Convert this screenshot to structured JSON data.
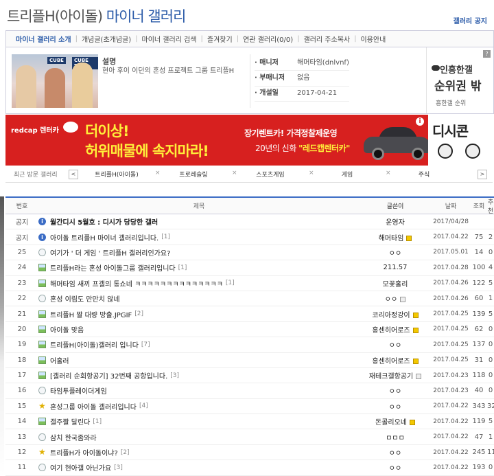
{
  "header": {
    "title_main": "트리플H(아이돌)",
    "title_sub": "마이너 갤러리",
    "gallery_notice": "갤러리 공지"
  },
  "tabs": [
    "마이너 갤러리 소개",
    "개념글(초개념글)",
    "마이너 갤러리 검색",
    "즐겨찾기",
    "연관 갤러리(0/0)",
    "갤러리 주소복사",
    "이용안내"
  ],
  "info": {
    "desc_label": "설명",
    "desc_text": "현아 후이 이던의 혼성 프로젝트 그룹 트리플H",
    "manager_label": "· 매니저",
    "manager": "해머타임(dnlvnf)",
    "submanager_label": "· 부매니저",
    "submanager": "없음",
    "opened_label": "· 개설일",
    "opened": "2017-04-21",
    "thumb_logo": "CUBE",
    "thumb_logo2": "CUBE TV"
  },
  "rank": {
    "line1": "인흥한갤",
    "line2": "순위권 밖",
    "line3": "흥한갤 순위",
    "info": "?"
  },
  "banner": {
    "brand": "redcap 렌터카",
    "big1": "더이상!",
    "big2": "허위매물에 속지마라!",
    "sub1": "장기렌트카! 가격정찰제운영",
    "sub2_a": "20년의 신화",
    "sub2_b": "\"레드캡렌터카\"",
    "dcon": "디시콘"
  },
  "recent": {
    "label": "최근 방문 갤러리",
    "items": [
      "트리플H(아이돌)",
      "프로레슬링",
      "스포츠게임",
      "게임",
      "주식"
    ],
    "prev": "<",
    "next": ">"
  },
  "table": {
    "headers": {
      "num": "번호",
      "title": "제목",
      "writer": "글쓴이",
      "date": "날짜",
      "views": "조회",
      "rec": "추천"
    },
    "rows": [
      {
        "num": "공지",
        "icon": "notice",
        "title": "월간디시 5월호 : 디시가 당당한 갤러",
        "comments": "",
        "writer": "운영자",
        "wbadge": "",
        "date": "2017/04/28",
        "views": "",
        "rec": "",
        "notice": true
      },
      {
        "num": "공지",
        "icon": "notice",
        "title": "아이돌 트리플H 마이너 갤러리입니다.",
        "comments": "[1]",
        "writer": "해머타임",
        "wbadge": "gold",
        "date": "2017.04.22",
        "views": "75",
        "rec": "2",
        "notice": false
      },
      {
        "num": "25",
        "icon": "text",
        "title": "여기가 ' 더 게임 ' 트리플H 갤러리인가요?",
        "comments": "",
        "writer": "ㅇㅇ",
        "wbadge": "",
        "date": "2017.05.01",
        "views": "14",
        "rec": "0",
        "notice": false
      },
      {
        "num": "24",
        "icon": "image",
        "title": "트리플H라는 혼성 아이돌그룹 갤러리입니다",
        "comments": "[1]",
        "writer": "211.57",
        "wbadge": "",
        "date": "2017.04.28",
        "views": "100",
        "rec": "4",
        "notice": false
      },
      {
        "num": "23",
        "icon": "image",
        "title": "해머타임 새끼 프갤의 통쇼네 ㅋㅋㅋㅋㅋㅋㅋㅋㅋㅋㅋㅋㅋㅋ",
        "comments": "[1]",
        "writer": "모꽃홀리",
        "wbadge": "",
        "date": "2017.04.26",
        "views": "122",
        "rec": "5",
        "notice": false
      },
      {
        "num": "22",
        "icon": "text",
        "title": "혼성 이림도 만만치 않네",
        "comments": "",
        "writer": "ㅇㅇ",
        "wbadge": "grey",
        "date": "2017.04.26",
        "views": "60",
        "rec": "1",
        "notice": false
      },
      {
        "num": "21",
        "icon": "image",
        "title": "트리플H 짤 대량 방출.JPGIF",
        "comments": "[2]",
        "writer": "코리아정강이",
        "wbadge": "gold",
        "date": "2017.04.25",
        "views": "139",
        "rec": "5",
        "notice": false
      },
      {
        "num": "20",
        "icon": "image",
        "title": "아이돌 맞음",
        "comments": "",
        "writer": "홍센히어로즈",
        "wbadge": "gold",
        "date": "2017.04.25",
        "views": "62",
        "rec": "0",
        "notice": false
      },
      {
        "num": "19",
        "icon": "image",
        "title": "트리플H(아이돌)갤러리 입니다",
        "comments": "[7]",
        "writer": "ㅇㅇ",
        "wbadge": "",
        "date": "2017.04.25",
        "views": "137",
        "rec": "0",
        "notice": false
      },
      {
        "num": "18",
        "icon": "image",
        "title": "어홀러",
        "comments": "",
        "writer": "홍센히어로즈",
        "wbadge": "gold",
        "date": "2017.04.25",
        "views": "31",
        "rec": "0",
        "notice": false
      },
      {
        "num": "17",
        "icon": "image",
        "title": "[갤러리 순회항공기] 32번째 공항입니다.",
        "comments": "[3]",
        "writer": "재테크갤항공기",
        "wbadge": "grey",
        "date": "2017.04.23",
        "views": "118",
        "rec": "0",
        "notice": false
      },
      {
        "num": "16",
        "icon": "text",
        "title": "타임투플레이더게임",
        "comments": "",
        "writer": "ㅇㅇ",
        "wbadge": "",
        "date": "2017.04.23",
        "views": "40",
        "rec": "0",
        "notice": false
      },
      {
        "num": "15",
        "icon": "star",
        "title": "혼성그룹 아이돌 갤러리입니다",
        "comments": "[4]",
        "writer": "ㅇㅇ",
        "wbadge": "",
        "date": "2017.04.22",
        "views": "343",
        "rec": "32",
        "notice": false
      },
      {
        "num": "14",
        "icon": "image",
        "title": "갤주짤 달린다",
        "comments": "[1]",
        "writer": "돈콜리오네",
        "wbadge": "gold",
        "date": "2017.04.22",
        "views": "119",
        "rec": "5",
        "notice": false
      },
      {
        "num": "13",
        "icon": "text",
        "title": "삼치 한국좀와라",
        "comments": "",
        "writer": "ㅁㅁㅁ",
        "wbadge": "",
        "date": "2017.04.22",
        "views": "47",
        "rec": "1",
        "notice": false
      },
      {
        "num": "12",
        "icon": "star",
        "title": "트리플H가 아이돌이냐?",
        "comments": "[2]",
        "writer": "ㅇㅇ",
        "wbadge": "",
        "date": "2017.04.22",
        "views": "245",
        "rec": "11",
        "notice": false
      },
      {
        "num": "11",
        "icon": "text",
        "title": "여기 현아갤 아닌가요",
        "comments": "[3]",
        "writer": "ㅇㅇ",
        "wbadge": "",
        "date": "2017.04.22",
        "views": "193",
        "rec": "0",
        "notice": false
      }
    ]
  }
}
